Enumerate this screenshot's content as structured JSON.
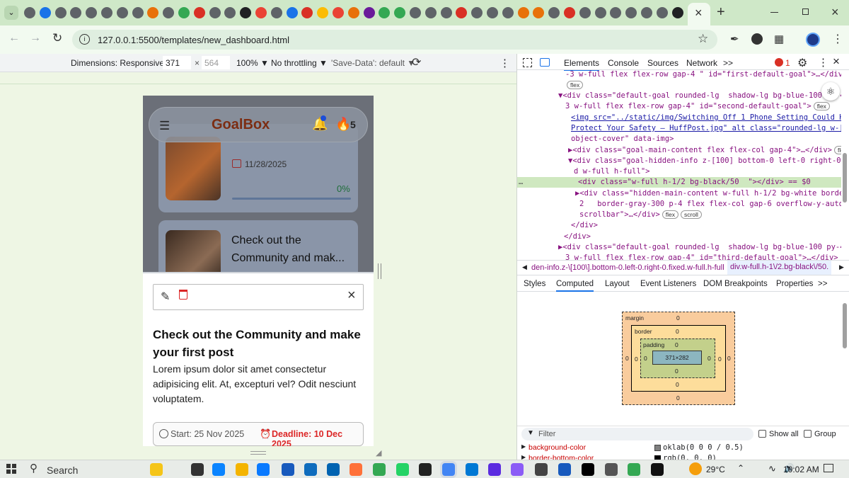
{
  "browser": {
    "url": "127.0.0.1:5500/templates/new_dashboard.html",
    "new_tab": "+",
    "close_tab": "×"
  },
  "device_toolbar": {
    "dimensions_label": "Dimensions: Responsive ▼",
    "width": "371",
    "times": "×",
    "height": "564",
    "zoom": "100% ▼",
    "throttle": "No throttling ▼",
    "save_data": "'Save-Data': default ▼"
  },
  "app": {
    "logo": "GoalBox",
    "streak": "5",
    "card1_date": "11/28/2025",
    "card1_progress_text": "0%",
    "card1_progress": 0,
    "card2_title": "Check out the Community and mak...",
    "detail_title": "Check out the Community and make your first post",
    "detail_body": "Lorem ipsum dolor sit amet consectetur adipisicing elit. At, excepturi vel? Odit nesciunt voluptatem.",
    "start": "Start: 25 Nov 2025",
    "deadline": "Deadline: 10 Dec 2025"
  },
  "devtools": {
    "tabs": [
      "Elements",
      "Console",
      "Sources",
      "Network",
      ">>"
    ],
    "error_count": "1",
    "breadcrumb1": "den-info.z-\\[100\\].bottom-0.left-0.right-0.fixed.w-full.h-full",
    "breadcrumb2": "div.w-full.h-1\\/2.bg-black\\/50.",
    "subtabs": [
      "Styles",
      "Computed",
      "Layout",
      "Event Listeners",
      "DOM Breakpoints",
      "Properties",
      ">>"
    ],
    "boxmodel": {
      "margin": "margin",
      "border": "border",
      "padding": "padding",
      "content": "371×282",
      "zero": "0",
      "dash": "-"
    },
    "filter_placeholder": "Filter",
    "show_all": "Show all",
    "group": "Group",
    "prop1": "background-color",
    "prop1_val": "oklab(0 0 0 / 0.5)",
    "prop2": "border-bottom-color",
    "prop2_val": "rgb(0, 0, 0)",
    "code": [
      "-3 w-full flex flex-row gap-4 \" id=\"first-default-goal\">…</div>",
      "flex",
      "▼<div class=\"default-goal rounded-lg  shadow-lg bg-blue-100 py-4 px-",
      "3 w-full flex flex-row gap-4\" id=\"second-default-goal\">",
      "<img src=\"../static/img/Switching Off 1 Phone Setting Could Help",
      "Protect Your Safety – HuffPost.jpg\" alt class=\"rounded-lg w-[30%]",
      "object-cover\" data-img>",
      "▶<div class=\"goal-main-content flex flex-col gap-4\">…</div>",
      "▼<div class=\"goal-hidden-info z-[100] bottom-0 left-0 right-0 fixe",
      "d w-full h-full\">",
      "<div class=\"w-full h-1/2 bg-black/50  \"></div> == $0",
      "▶<div class=\"hidden-main-content w-full h-1/2 bg-white border-t-",
      "2   border-gray-300 p-4 flex flex-col gap-6 overflow-y-auto no-",
      "scrollbar\">…</div>",
      "</div>",
      "</div>",
      "▶<div class=\"default-goal rounded-lg  shadow-lg bg-blue-100 py-4 px-",
      "3 w-full flex flex-row gap-4\" id=\"third-default-goal\">…</div>"
    ],
    "badges": [
      "flex",
      "flex",
      "flex",
      "flex",
      "scroll"
    ],
    "dots": "…"
  },
  "taskbar": {
    "search": "Search",
    "temp": "29°C",
    "time": "10:02 AM"
  },
  "colors": {
    "accent": "#0b57d0",
    "logo": "#c2410c",
    "deadline": "#dc2626",
    "progress_text": "#16a34a"
  }
}
